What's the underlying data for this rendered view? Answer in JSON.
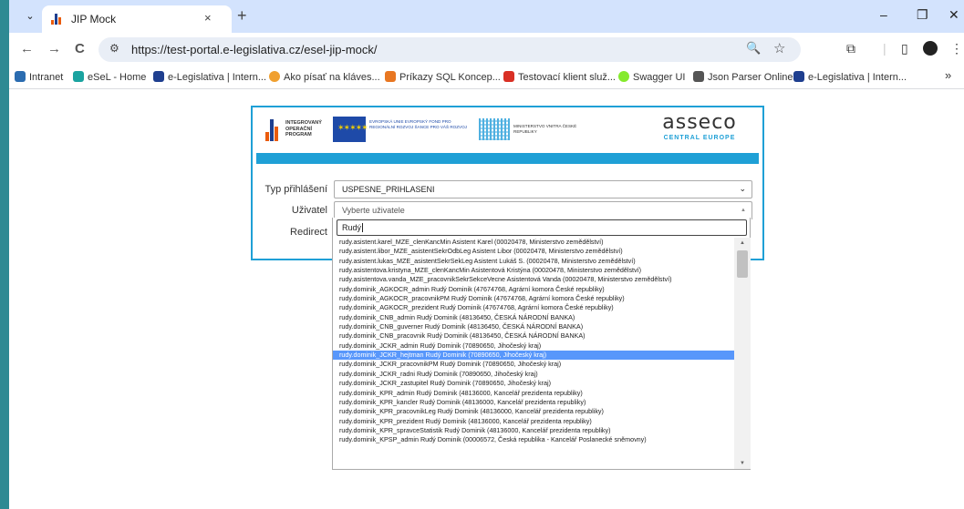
{
  "browser": {
    "tab_title": "JIP Mock",
    "tab_close": "×",
    "new_tab": "+",
    "url": "https://test-portal.e-legislativa.cz/esel-jip-mock/",
    "window_controls": [
      "–",
      "❐",
      "✕"
    ],
    "nav": {
      "back": "←",
      "forward": "→",
      "reload": "C"
    }
  },
  "bookmarks": [
    {
      "label": "Intranet",
      "icon": "intranet-icon",
      "color": "#2b6cb0"
    },
    {
      "label": "eSeL - Home",
      "icon": "esel-icon",
      "color": "#1aa3a0"
    },
    {
      "label": "e-Legislativa | Intern...",
      "icon": "ne-icon",
      "color": "#1f3f8f"
    },
    {
      "label": "Ako písať na kláves...",
      "icon": "globe-icon",
      "color": "#f0a030"
    },
    {
      "label": "Príkazy SQL Koncep...",
      "icon": "sql-icon",
      "color": "#e87722"
    },
    {
      "label": "Testovací klient služ...",
      "icon": "client-icon",
      "color": "#d93025"
    },
    {
      "label": "Swagger UI",
      "icon": "swagger-icon",
      "color": "#85ea2d"
    },
    {
      "label": "Json Parser Online",
      "icon": "json-icon",
      "color": "#555555"
    },
    {
      "label": "e-Legislativa | Intern...",
      "icon": "ne-icon",
      "color": "#1f3f8f"
    }
  ],
  "bookmarks_more": "»",
  "logos": {
    "iop": "INTEGROVANÝ OPERAČNÍ PROGRAM",
    "eu": "EVROPSKÁ UNIE EVROPSKÝ FOND PRO REGIONÁLNÍ ROZVOJ ŠANCE PRO VÁŠ ROZVOJ",
    "mv": "MINISTERSTVO VNITRA ČESKÉ REPUBLIKY",
    "asseco_main": "asseco",
    "asseco_sub": "CENTRAL EUROPE"
  },
  "form": {
    "typ_label": "Typ přihlášení",
    "typ_value": "USPESNE_PRIHLASENI",
    "uzivatel_label": "Uživatel",
    "uzivatel_placeholder": "Vyberte uživatele",
    "redirect_label": "Redirect",
    "search_query": "Rudý"
  },
  "options": [
    "rudy.asistent.karel_MZE_clenKancMin Asistent Karel (00020478, Ministerstvo zemědělství)",
    "rudy.asistent.libor_MZE_asistentSekrOdbLeg Asistent Libor (00020478, Ministerstvo zemědělství)",
    "rudy.asistent.lukas_MZE_asistentSekrSekLeg Asistent Lukáš S. (00020478, Ministerstvo zemědělství)",
    "rudy.asistentova.kristyna_MZE_clenKancMin Asistentová Kristýna (00020478, Ministerstvo zemědělství)",
    "rudy.asistentova.vanda_MZE_pracovnikSekrSekceVecne Asistentová Vanda (00020478, Ministerstvo zemědělství)",
    "rudy.dominik_AGKOCR_admin Rudý Dominik (47674768, Agrární komora České republiky)",
    "rudy.dominik_AGKOCR_pracovnikPM Rudý Dominik (47674768, Agrární komora České republiky)",
    "rudy.dominik_AGKOCR_prezident Rudý Dominik (47674768, Agrární komora České republiky)",
    "rudy.dominik_CNB_admin Rudý Dominik (48136450, ČESKÁ NÁRODNÍ BANKA)",
    "rudy.dominik_CNB_guverner Rudý Dominik (48136450, ČESKÁ NÁRODNÍ BANKA)",
    "rudy.dominik_CNB_pracovnik Rudý Dominik (48136450, ČESKÁ NÁRODNÍ BANKA)",
    "rudy.dominik_JCKR_admin Rudý Dominik (70890650, Jihočeský kraj)",
    "rudy.dominik_JCKR_hejtman Rudý Dominik (70890650, Jihočeský kraj)",
    "rudy.dominik_JCKR_pracovnikPM Rudý Dominik (70890650, Jihočeský kraj)",
    "rudy.dominik_JCKR_radni Rudý Dominik (70890650, Jihočeský kraj)",
    "rudy.dominik_JCKR_zastupitel Rudý Dominik (70890650, Jihočeský kraj)",
    "rudy.dominik_KPR_admin Rudý Dominik (48136000, Kancelář prezidenta republiky)",
    "rudy.dominik_KPR_kancler Rudý Dominik (48136000, Kancelář prezidenta republiky)",
    "rudy.dominik_KPR_pracovnikLeg Rudý Dominik (48136000, Kancelář prezidenta republiky)",
    "rudy.dominik_KPR_prezident Rudý Dominik (48136000, Kancelář prezidenta republiky)",
    "rudy.dominik_KPR_spravceStatistik Rudý Dominik (48136000, Kancelář prezidenta republiky)",
    "rudy.dominik_KPSP_admin Rudý Dominik (00006572, Česká republika - Kancelář Poslanecké sněmovny)"
  ],
  "highlighted_index": 12,
  "colors": {
    "accent": "#1fa0d6",
    "highlight": "#5897fb",
    "desktop": "#2e8a93"
  }
}
